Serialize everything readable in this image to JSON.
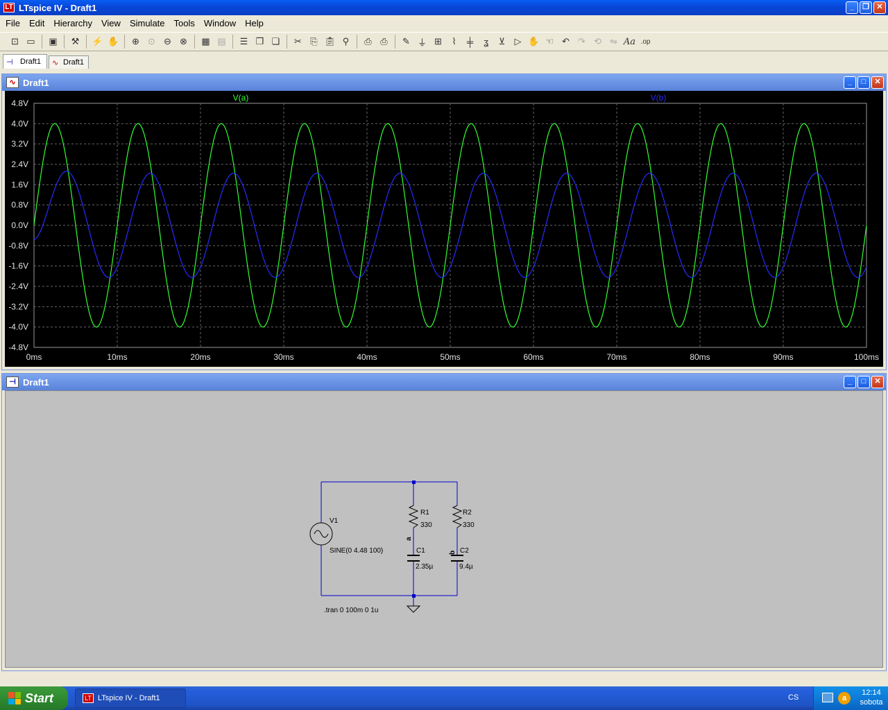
{
  "app": {
    "title": "LTspice IV - Draft1",
    "logo_glyph": "LT"
  },
  "menu": [
    "File",
    "Edit",
    "Hierarchy",
    "View",
    "Simulate",
    "Tools",
    "Window",
    "Help"
  ],
  "tabs": [
    {
      "label": "Draft1",
      "icon": "schematic-icon"
    },
    {
      "label": "Draft1",
      "icon": "waveform-icon"
    }
  ],
  "waveform_window": {
    "title": "Draft1"
  },
  "schematic_window": {
    "title": "Draft1"
  },
  "chart_data": {
    "type": "line",
    "xlabel": "",
    "ylabel": "",
    "xlim": [
      0,
      100
    ],
    "ylim": [
      -4.8,
      4.8
    ],
    "x_ticks": [
      "0ms",
      "10ms",
      "20ms",
      "30ms",
      "40ms",
      "50ms",
      "60ms",
      "70ms",
      "80ms",
      "90ms",
      "100ms"
    ],
    "y_ticks": [
      "4.8V",
      "4.0V",
      "3.2V",
      "2.4V",
      "1.6V",
      "0.8V",
      "0.0V",
      "-0.8V",
      "-1.6V",
      "-2.4V",
      "-3.2V",
      "-4.0V",
      "-4.8V"
    ],
    "grid": true,
    "background": "#000000",
    "series": [
      {
        "name": "V(a)",
        "color": "#33ff33",
        "frequency_hz": 100,
        "amplitude": 4.0,
        "phase_deg": 0,
        "x": [
          0,
          2.5,
          7.5,
          12.5,
          17.5,
          22.5,
          27.5,
          32.5,
          37.5,
          42.5,
          47.5,
          52.5,
          57.5,
          62.5,
          67.5,
          72.5,
          77.5,
          82.5,
          87.5,
          92.5,
          97.5,
          100
        ],
        "y": [
          0,
          4.0,
          -4.0,
          4.0,
          -4.0,
          4.0,
          -4.0,
          4.0,
          -4.0,
          4.0,
          -4.0,
          4.0,
          -4.0,
          4.0,
          -4.0,
          4.0,
          -4.0,
          4.0,
          -4.0,
          4.0,
          -4.0,
          -2.0
        ]
      },
      {
        "name": "V(b)",
        "color": "#2a2aff",
        "frequency_hz": 100,
        "amplitude": 2.05,
        "phase_deg": -53,
        "x": [
          0,
          4.0,
          9.0,
          14.0,
          19.0,
          24.0,
          29.0,
          34.0,
          39.0,
          44.0,
          49.0,
          54.0,
          59.0,
          64.0,
          69.0,
          74.0,
          79.0,
          84.0,
          89.0,
          94.0,
          99.0,
          100
        ],
        "y": [
          0,
          2.5,
          -1.95,
          2.05,
          -2.05,
          2.05,
          -2.05,
          2.05,
          -2.05,
          2.05,
          -2.05,
          2.05,
          -2.05,
          2.05,
          -2.05,
          2.05,
          -2.05,
          2.05,
          -2.05,
          2.05,
          -2.05,
          -1.95
        ]
      }
    ]
  },
  "schematic": {
    "v1_name": "V1",
    "v1_value": "SINE(0 4.48 100)",
    "r1_name": "R1",
    "r1_value": "330",
    "r2_name": "R2",
    "r2_value": "330",
    "c1_name": "C1",
    "c1_value": "2.35µ",
    "c2_name": "C2",
    "c2_value": "9.4µ",
    "net_a": "a",
    "net_b": "b",
    "directive": ".tran 0 100m 0 1u",
    "wire_color": "#0000cc"
  },
  "taskbar": {
    "start_label": "Start",
    "task_label": "LTspice IV - Draft1",
    "language": "CS",
    "clock_time": "12:14",
    "clock_day": "sobota"
  }
}
